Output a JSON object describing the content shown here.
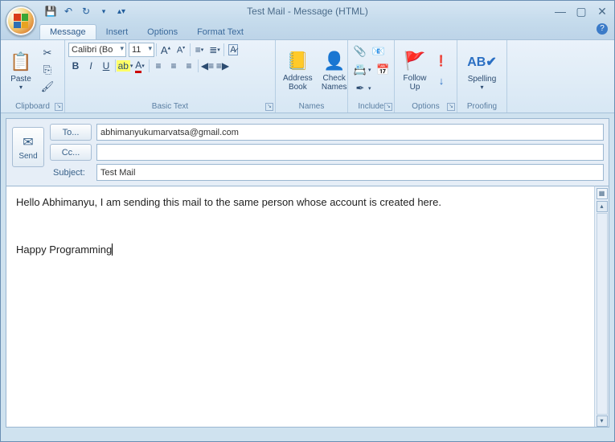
{
  "window": {
    "title": "Test Mail - Message (HTML)"
  },
  "qat": {
    "save_tip": "Save",
    "undo_tip": "Undo",
    "redo_tip": "Redo"
  },
  "tabs": {
    "message": "Message",
    "insert": "Insert",
    "options": "Options",
    "format_text": "Format Text"
  },
  "ribbon": {
    "clipboard": {
      "label": "Clipboard",
      "paste": "Paste"
    },
    "basic_text": {
      "label": "Basic Text",
      "font_name": "Calibri (Bo",
      "font_size": "11"
    },
    "names": {
      "label": "Names",
      "address_book": "Address\nBook",
      "check_names": "Check\nNames"
    },
    "include": {
      "label": "Include"
    },
    "options": {
      "label": "Options",
      "follow_up": "Follow\nUp"
    },
    "proofing": {
      "label": "Proofing",
      "spelling": "Spelling"
    }
  },
  "header": {
    "send": "Send",
    "to_btn": "To...",
    "cc_btn": "Cc...",
    "subject_label": "Subject:",
    "to_value": "abhimanyukumarvatsa@gmail.com",
    "cc_value": "",
    "subject_value": "Test Mail"
  },
  "body": {
    "line1": "Hello Abhimanyu, I am sending this mail to the same person whose account is created here.",
    "line2": "Happy Programming"
  }
}
